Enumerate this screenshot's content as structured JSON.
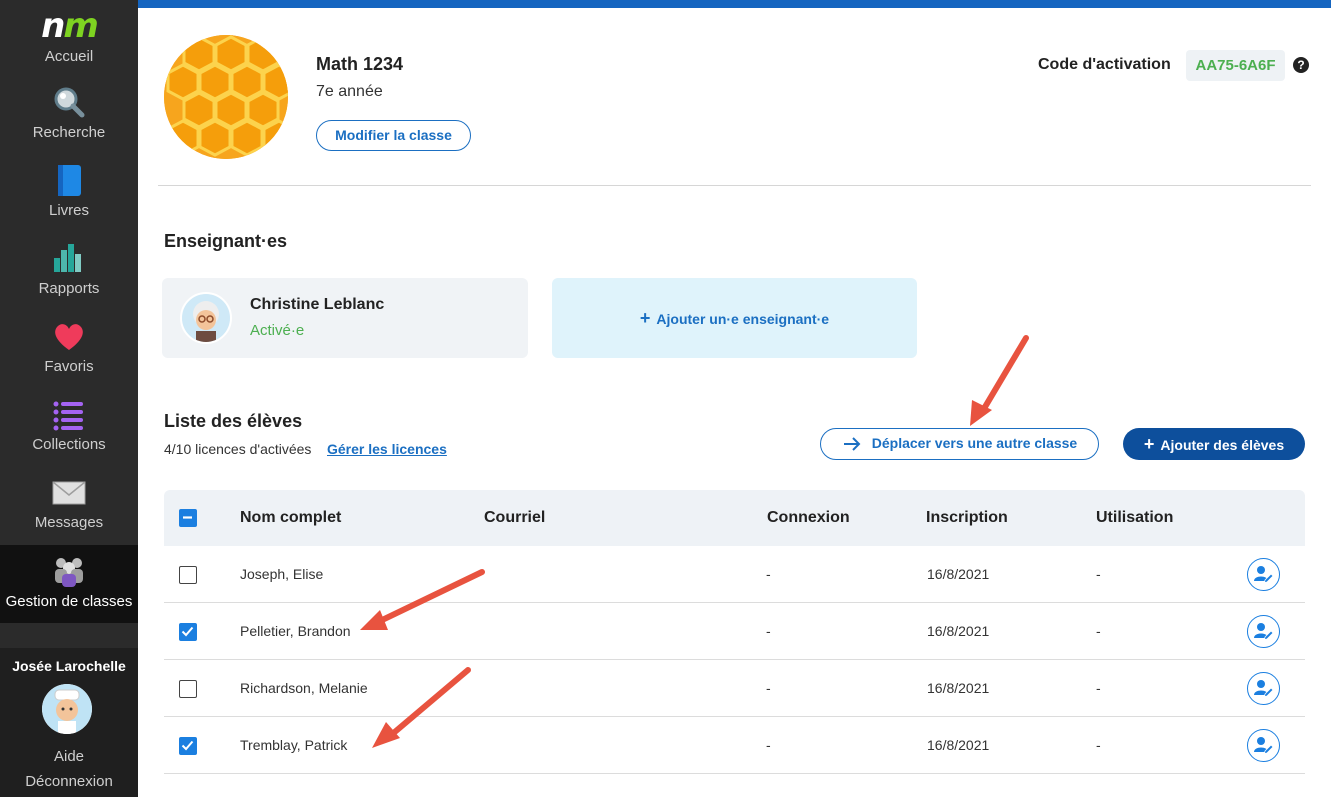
{
  "sidebar": {
    "logo": "nm",
    "items": [
      {
        "label": "Accueil",
        "icon": "home-logo"
      },
      {
        "label": "Recherche",
        "icon": "magnifier-icon"
      },
      {
        "label": "Livres",
        "icon": "book-icon"
      },
      {
        "label": "Rapports",
        "icon": "bar-chart-icon"
      },
      {
        "label": "Favoris",
        "icon": "heart-icon"
      },
      {
        "label": "Collections",
        "icon": "list-icon"
      },
      {
        "label": "Messages",
        "icon": "envelope-icon"
      },
      {
        "label": "Gestion de classes",
        "icon": "group-icon",
        "active": true
      }
    ],
    "user_name": "Josée Larochelle",
    "help": "Aide",
    "logout": "Déconnexion"
  },
  "header": {
    "class_name": "Math 1234",
    "grade": "7e année",
    "modify_button": "Modifier la classe",
    "activation_label": "Code d'activation",
    "activation_code": "AA75-6A6F",
    "help_icon": "?"
  },
  "teachers": {
    "title": "Enseignant·es",
    "list": [
      {
        "name": "Christine Leblanc",
        "status": "Activé·e"
      }
    ],
    "add_label": "Ajouter un·e enseignant·e"
  },
  "students": {
    "title": "Liste des élèves",
    "licences": "4/10 licences d'activées",
    "manage_link": "Gérer les licences",
    "move_button": "Déplacer vers une autre classe",
    "add_button": "Ajouter des élèves",
    "columns": [
      "Nom complet",
      "Courriel",
      "Connexion",
      "Inscription",
      "Utilisation"
    ],
    "rows": [
      {
        "name": "Joseph, Elise",
        "email": "",
        "login": "-",
        "signup": "16/8/2021",
        "usage": "-",
        "checked": false
      },
      {
        "name": "Pelletier, Brandon",
        "email": "",
        "login": "-",
        "signup": "16/8/2021",
        "usage": "-",
        "checked": true
      },
      {
        "name": "Richardson, Melanie",
        "email": "",
        "login": "-",
        "signup": "16/8/2021",
        "usage": "-",
        "checked": false
      },
      {
        "name": "Tremblay, Patrick",
        "email": "",
        "login": "-",
        "signup": "16/8/2021",
        "usage": "-",
        "checked": true
      }
    ]
  },
  "colors": {
    "accent": "#1b6fc2",
    "primary_dark": "#0d4f9c",
    "success": "#4caf50",
    "annotation_arrow": "#e8533f"
  }
}
